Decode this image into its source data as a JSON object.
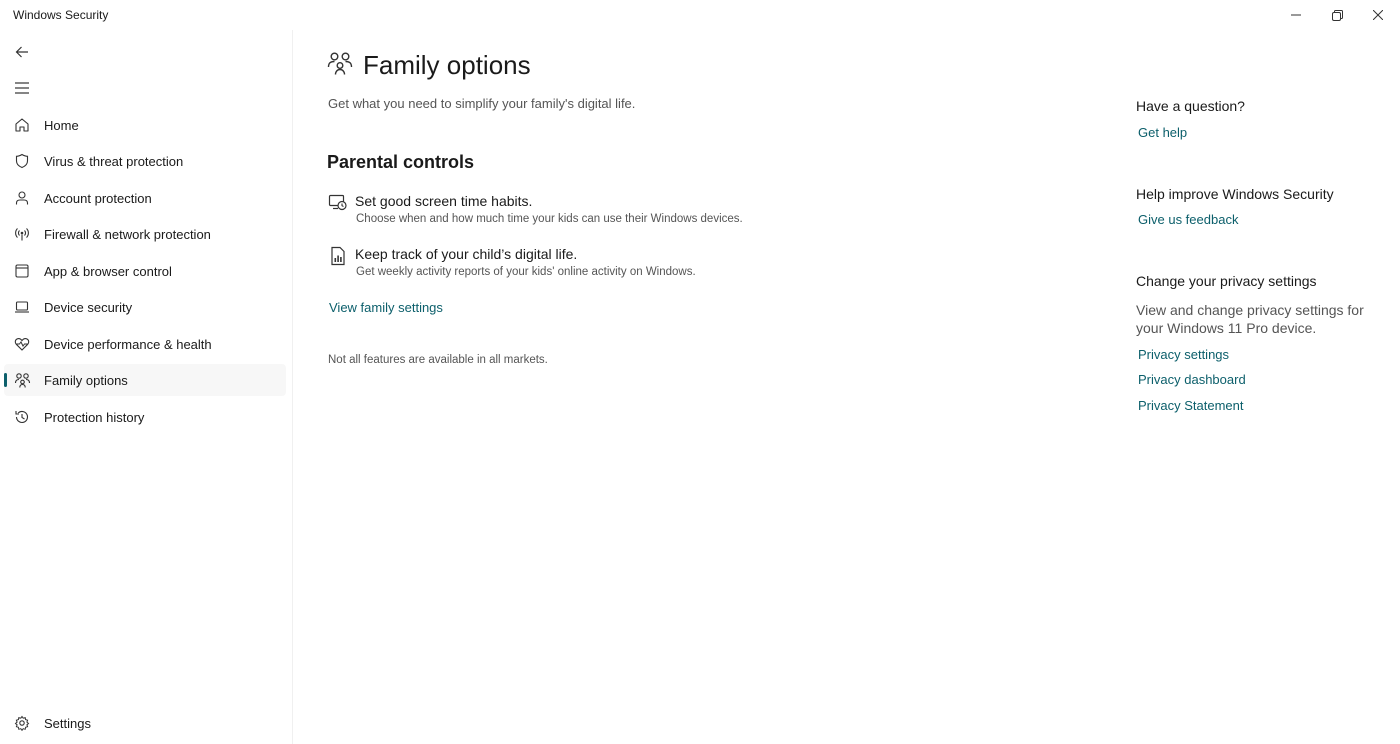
{
  "window": {
    "title": "Windows Security",
    "controls": [
      "minimize",
      "restore",
      "close"
    ]
  },
  "sidebar": {
    "items": [
      {
        "label": "Home",
        "icon": "home-icon"
      },
      {
        "label": "Virus & threat protection",
        "icon": "shield-icon"
      },
      {
        "label": "Account protection",
        "icon": "person-icon"
      },
      {
        "label": "Firewall & network protection",
        "icon": "antenna-icon"
      },
      {
        "label": "App & browser control",
        "icon": "app-window-icon"
      },
      {
        "label": "Device security",
        "icon": "laptop-icon"
      },
      {
        "label": "Device performance & health",
        "icon": "heart-pulse-icon"
      },
      {
        "label": "Family options",
        "icon": "family-icon",
        "selected": true
      },
      {
        "label": "Protection history",
        "icon": "history-icon"
      }
    ],
    "settings": {
      "label": "Settings",
      "icon": "gear-icon"
    }
  },
  "main": {
    "title": "Family options",
    "subtitle": "Get what you need to simplify your family's digital life.",
    "section_title": "Parental controls",
    "features": [
      {
        "title": "Set good screen time habits.",
        "description": "Choose when and how much time your kids can use their Windows devices.",
        "icon": "screen-time-icon"
      },
      {
        "title": "Keep track of your child’s digital life.",
        "description": "Get weekly activity reports of your kids' online activity on Windows.",
        "icon": "report-icon"
      }
    ],
    "view_link": "View family settings",
    "note": "Not all features are available in all markets."
  },
  "right": {
    "question_heading": "Have a question?",
    "get_help": "Get help",
    "improve_heading": "Help improve Windows Security",
    "feedback": "Give us feedback",
    "privacy_heading": "Change your privacy settings",
    "privacy_text": "View and change privacy settings for your Windows 11 Pro device.",
    "privacy_settings": "Privacy settings",
    "privacy_dashboard": "Privacy dashboard",
    "privacy_statement": "Privacy Statement"
  },
  "colors": {
    "accent": "#0c5f6b",
    "text": "#1a1a1a",
    "secondary_text": "#555555"
  }
}
